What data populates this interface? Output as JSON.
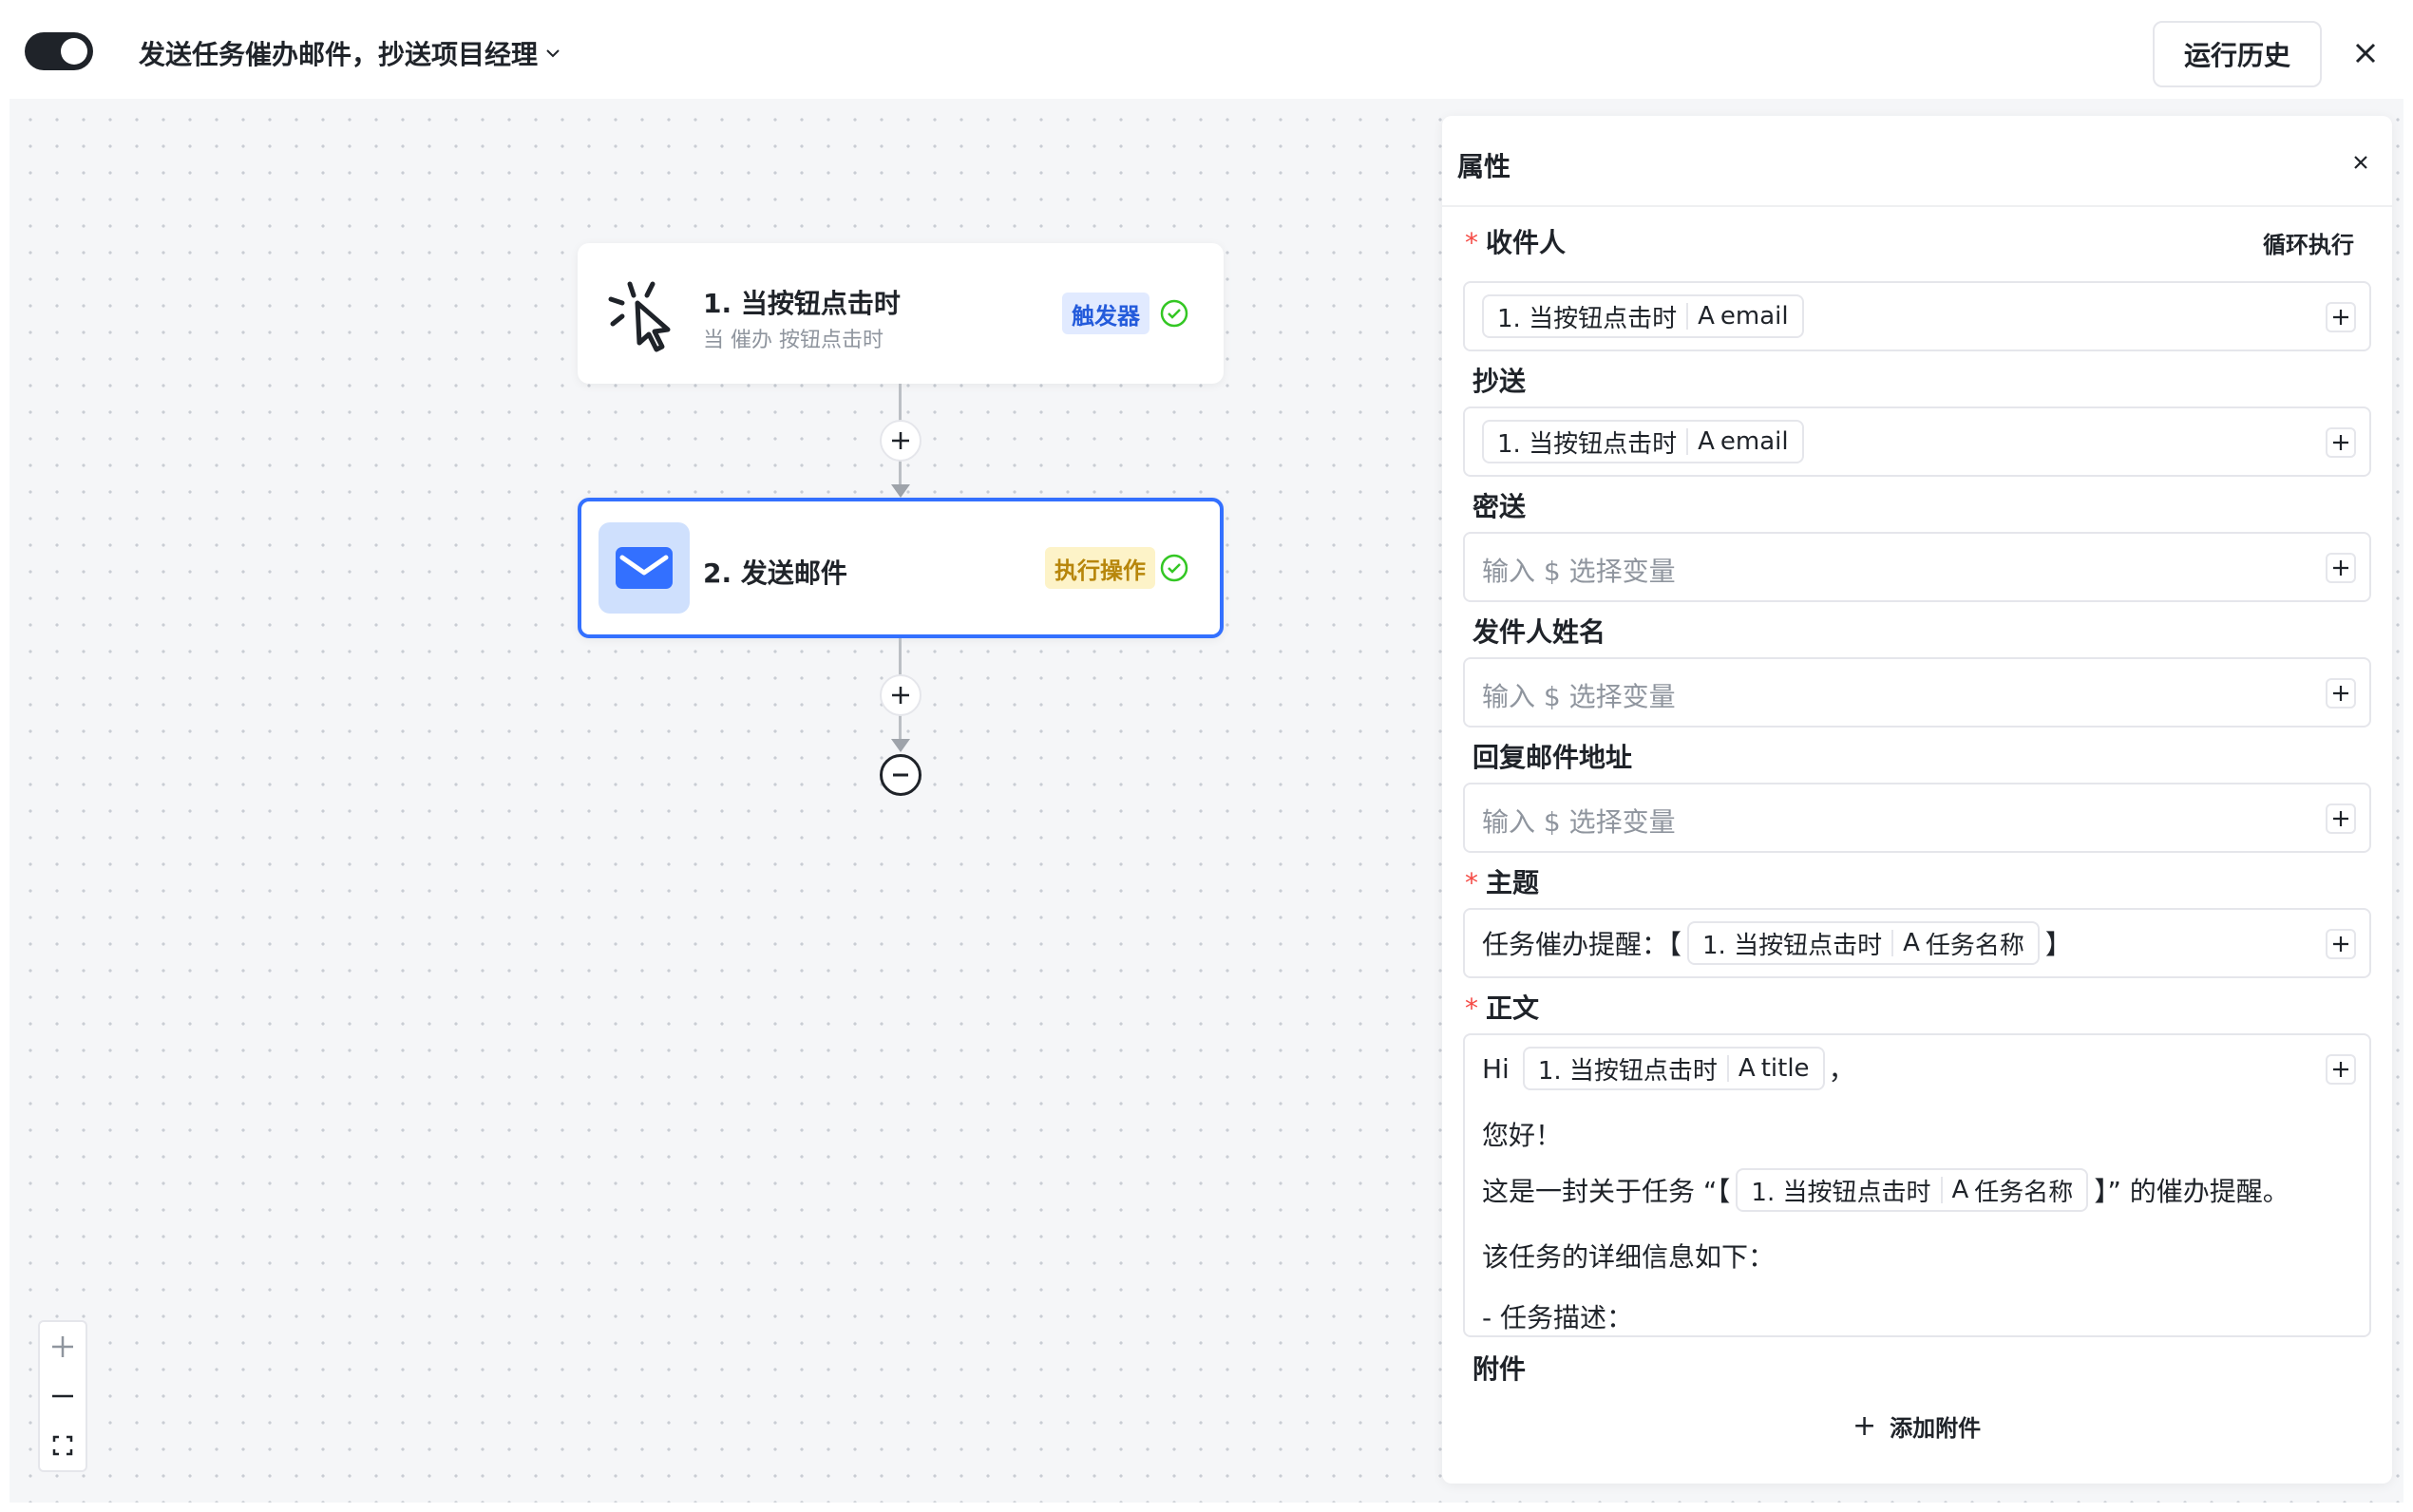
{
  "header": {
    "title": "发送任务催办邮件，抄送项目经理",
    "history_label": "运行历史"
  },
  "nodes": {
    "trigger": {
      "title": "1. 当按钮点击时",
      "subtitle": "当 催办 按钮点击时",
      "tag": "触发器"
    },
    "action": {
      "title": "2. 发送邮件",
      "tag": "执行操作"
    }
  },
  "panel": {
    "title": "属性",
    "loop_label": "循环执行",
    "recipient": {
      "label": "收件人",
      "chip_node": "1. 当按钮点击时",
      "chip_type": "A",
      "chip_field": "email"
    },
    "cc": {
      "label": "抄送",
      "chip_node": "1. 当按钮点击时",
      "chip_type": "A",
      "chip_field": "email"
    },
    "bcc": {
      "label": "密送",
      "placeholder": "输入 $ 选择变量"
    },
    "sender_name": {
      "label": "发件人姓名",
      "placeholder": "输入 $ 选择变量"
    },
    "reply_to": {
      "label": "回复邮件地址",
      "placeholder": "输入 $ 选择变量"
    },
    "subject": {
      "label": "主题",
      "prefix": "任务催办提醒：【",
      "chip_node": "1. 当按钮点击时",
      "chip_type": "A",
      "chip_field": "任务名称",
      "suffix": "】"
    },
    "body": {
      "label": "正文",
      "line1_prefix": "Hi",
      "line1_chip_node": "1. 当按钮点击时",
      "line1_chip_type": "A",
      "line1_chip_field": "title",
      "line1_suffix": "，",
      "line2": "您好！",
      "line3_prefix": "这是一封关于任务 “【",
      "line3_chip_node": "1. 当按钮点击时",
      "line3_chip_type": "A",
      "line3_chip_field": "任务名称",
      "line3_suffix": "】” 的催办提醒。",
      "line4": "该任务的详细信息如下：",
      "line5": "- 任务描述："
    },
    "attachment": {
      "label": "附件",
      "add_plus": "+",
      "add_label": "添加附件"
    }
  }
}
